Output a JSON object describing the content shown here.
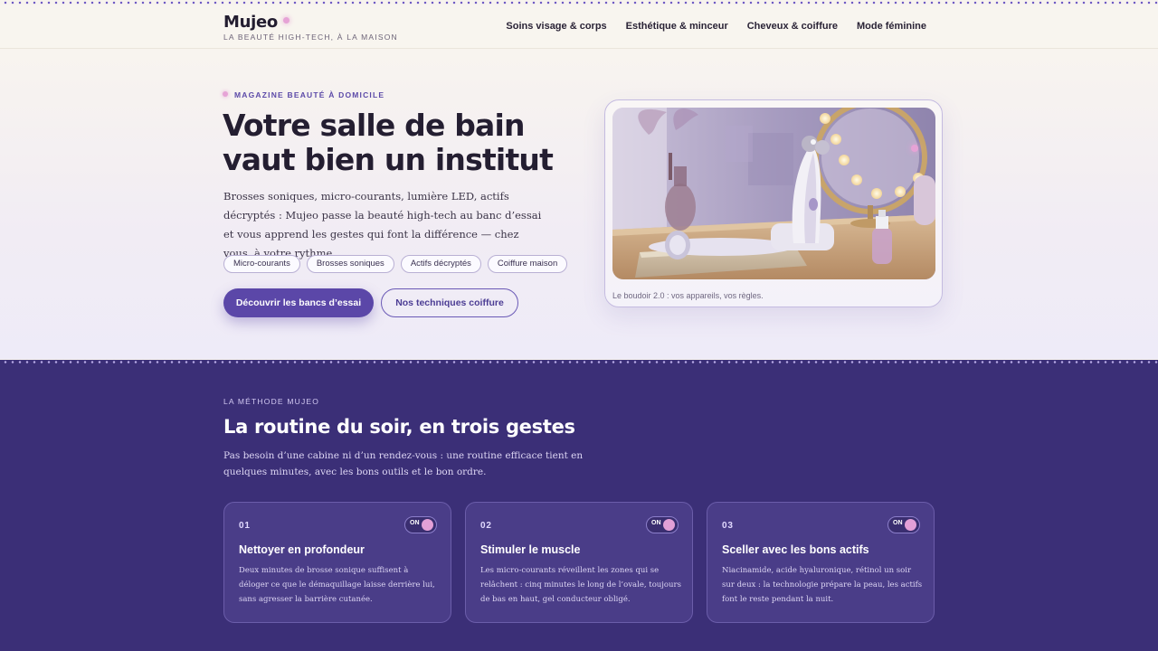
{
  "brand": {
    "name": "Mujeo",
    "tagline": "LA BEAUTÉ HIGH-TECH, À LA MAISON"
  },
  "nav": {
    "items": [
      {
        "label": "Soins visage & corps"
      },
      {
        "label": "Esthétique & minceur"
      },
      {
        "label": "Cheveux & coiffure"
      },
      {
        "label": "Mode féminine"
      }
    ]
  },
  "hero": {
    "kicker": "MAGAZINE BEAUTÉ À DOMICILE",
    "title": "Votre salle de bain vaut bien un institut",
    "lead": "Brosses soniques, micro-courants, lumière LED, actifs décryptés : Mujeo passe la beauté high-tech au banc d’essai et vous apprend les gestes qui font la différence — chez vous, à votre rythme.",
    "chips": [
      {
        "label": "Micro-courants"
      },
      {
        "label": "Brosses soniques"
      },
      {
        "label": "Actifs décryptés"
      },
      {
        "label": "Coiffure maison"
      }
    ],
    "primary_cta": "Découvrir les bancs d’essai",
    "secondary_cta": "Nos techniques coiffure",
    "image_caption": "Le boudoir 2.0 : vos appareils, vos règles."
  },
  "method": {
    "kicker": "LA MÉTHODE MUJEO",
    "title": "La routine du soir, en trois gestes",
    "lead": "Pas besoin d’une cabine ni d’un rendez-vous : une routine efficace tient en quelques minutes, avec les bons outils et le bon ordre.",
    "steps": [
      {
        "number": "01",
        "toggle": "ON",
        "title": "Nettoyer en profondeur",
        "text": "Deux minutes de brosse sonique suffisent à déloger ce que le démaquillage laisse derrière lui, sans agresser la barrière cutanée."
      },
      {
        "number": "02",
        "toggle": "ON",
        "title": "Stimuler le muscle",
        "text": "Les micro-courants réveillent les zones qui se relâchent : cinq minutes le long de l’ovale, toujours de bas en haut, gel conducteur obligé."
      },
      {
        "number": "03",
        "toggle": "ON",
        "title": "Sceller avec les bons actifs",
        "text": "Niacinamide, acide hyaluronique, rétinol un soir sur deux : la technologie prépare la peau, les actifs font le reste pendant la nuit."
      }
    ]
  },
  "colors": {
    "accent": "#5b47a8",
    "dark_band": "#3b2f77",
    "pink": "#e6a3d6"
  }
}
